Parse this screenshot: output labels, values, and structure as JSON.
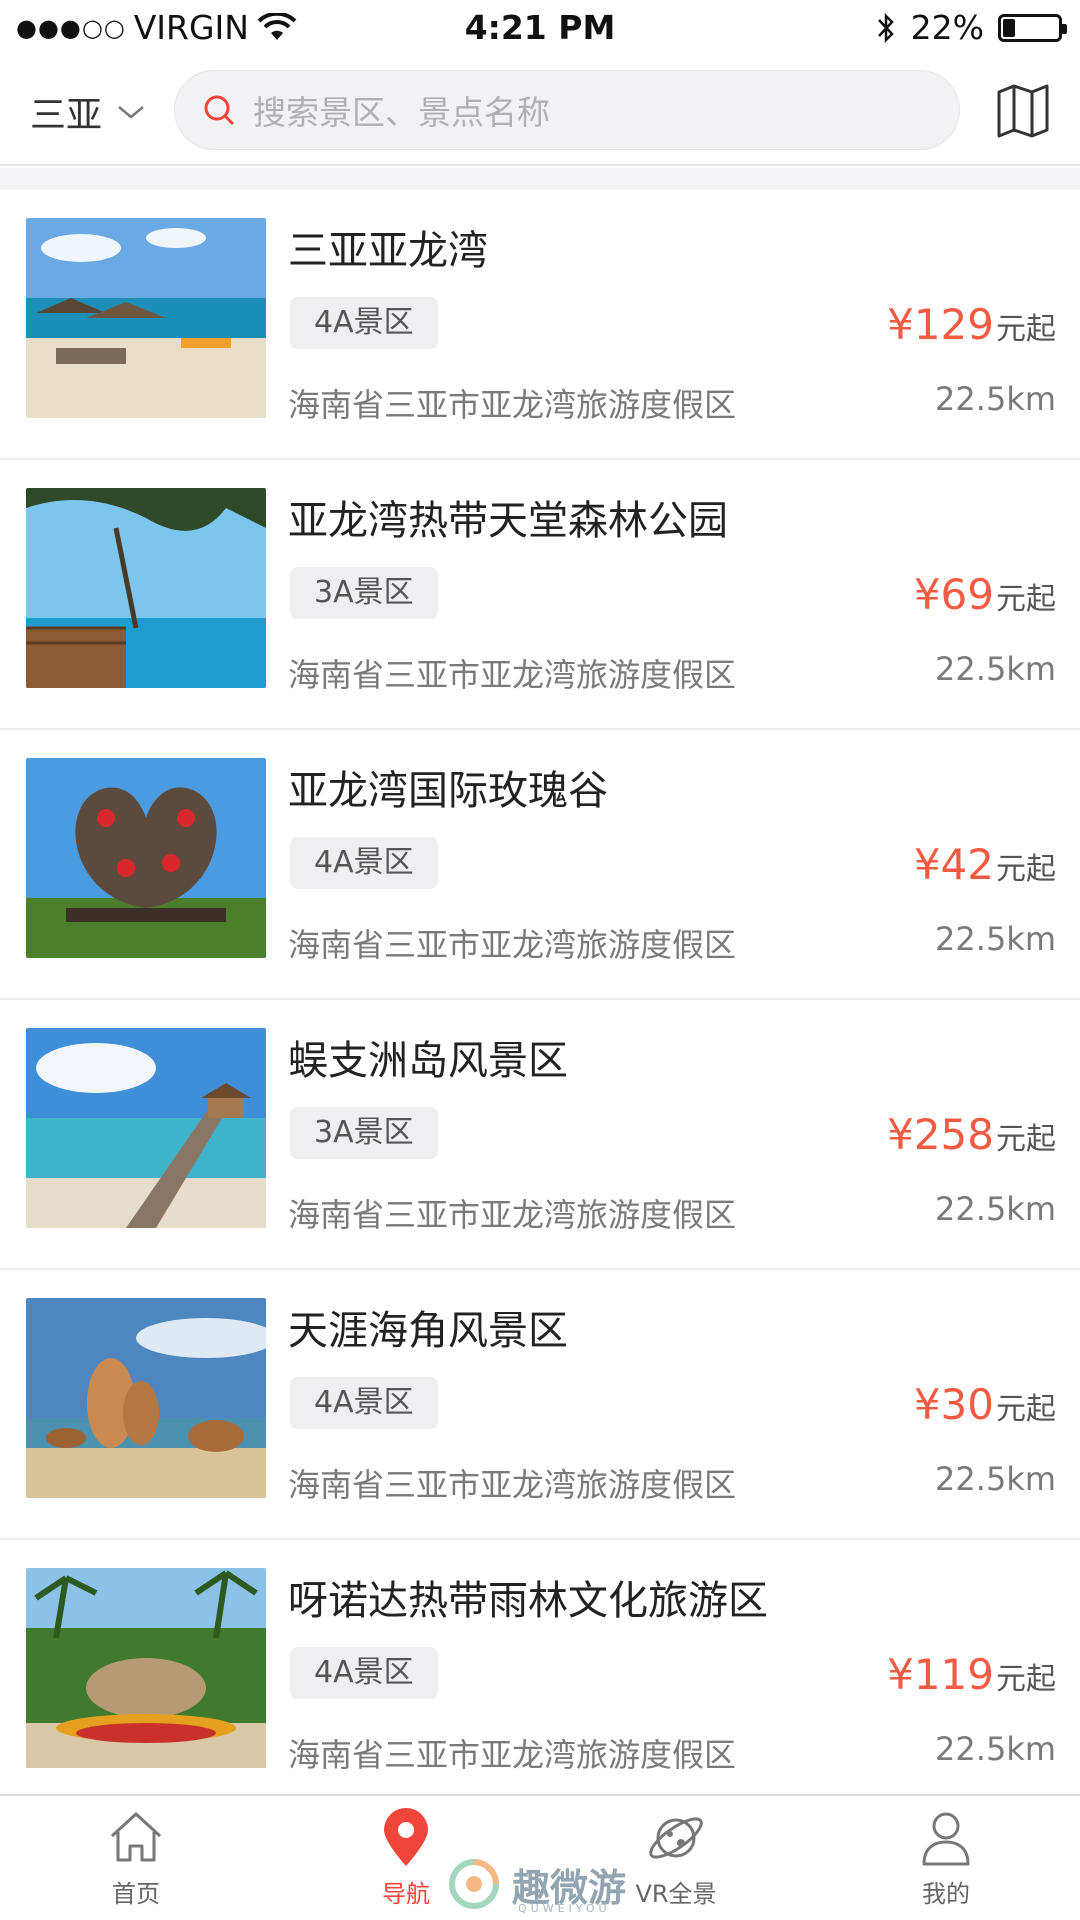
{
  "status": {
    "signal_dots": "●●●○○",
    "carrier": "VIRGIN",
    "time": "4:21 PM",
    "battery_text": "22%",
    "battery_level": 0.22
  },
  "header": {
    "city": "三亚",
    "search_placeholder": "搜索景区、景点名称"
  },
  "spots": [
    {
      "name": "三亚亚龙湾",
      "tag": "4A景区",
      "price": "¥129",
      "unit": "元起",
      "address": "海南省三亚市亚龙湾旅游度假区",
      "distance": "22.5km"
    },
    {
      "name": "亚龙湾热带天堂森林公园",
      "tag": "3A景区",
      "price": "¥69",
      "unit": "元起",
      "address": "海南省三亚市亚龙湾旅游度假区",
      "distance": "22.5km"
    },
    {
      "name": "亚龙湾国际玫瑰谷",
      "tag": "4A景区",
      "price": "¥42",
      "unit": "元起",
      "address": "海南省三亚市亚龙湾旅游度假区",
      "distance": "22.5km"
    },
    {
      "name": "蜈支洲岛风景区",
      "tag": "3A景区",
      "price": "¥258",
      "unit": "元起",
      "address": "海南省三亚市亚龙湾旅游度假区",
      "distance": "22.5km"
    },
    {
      "name": "天涯海角风景区",
      "tag": "4A景区",
      "price": "¥30",
      "unit": "元起",
      "address": "海南省三亚市亚龙湾旅游度假区",
      "distance": "22.5km"
    },
    {
      "name": "呀诺达热带雨林文化旅游区",
      "tag": "4A景区",
      "price": "¥119",
      "unit": "元起",
      "address": "海南省三亚市亚龙湾旅游度假区",
      "distance": "22.5km"
    }
  ],
  "tabs": [
    {
      "label": "首页",
      "icon": "home-icon"
    },
    {
      "label": "导航",
      "icon": "location-pin-icon",
      "active": true
    },
    {
      "label": "VR全景",
      "icon": "planet-icon"
    },
    {
      "label": "我的",
      "icon": "user-icon"
    }
  ],
  "watermark": {
    "text": "趣微游",
    "sub": "QUWEIYOU"
  },
  "colors": {
    "accent": "#f0453a",
    "price": "#f25a42"
  }
}
